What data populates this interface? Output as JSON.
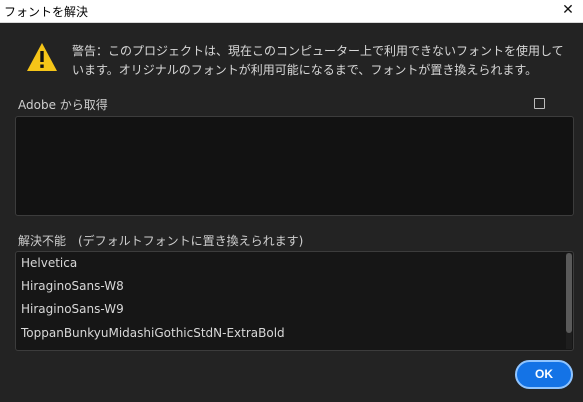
{
  "window": {
    "title": "フォントを解決",
    "close_glyph": "✕"
  },
  "warning": {
    "icon": "warning-triangle-icon",
    "icon_color": "#f5c518",
    "lines": [
      "警告：このプロジェクトは、現在このコンピューター上で利用できないフォントを使用して",
      "います。オリジナルのフォントが利用可能になるまで、フォントが置き換えられます。"
    ]
  },
  "adobe_section": {
    "label": "Adobe から取得",
    "checked": false
  },
  "unresolved_section": {
    "label": "解決不能　(デフォルトフォントに置き換えられます)",
    "fonts": [
      "Helvetica",
      "HiraginoSans-W8",
      "HiraginoSans-W9",
      "ToppanBunkyuMidashiGothicStdN-ExtraBold"
    ]
  },
  "buttons": {
    "ok_label": "OK"
  },
  "colors": {
    "accent": "#1473e6",
    "background": "#232323"
  }
}
